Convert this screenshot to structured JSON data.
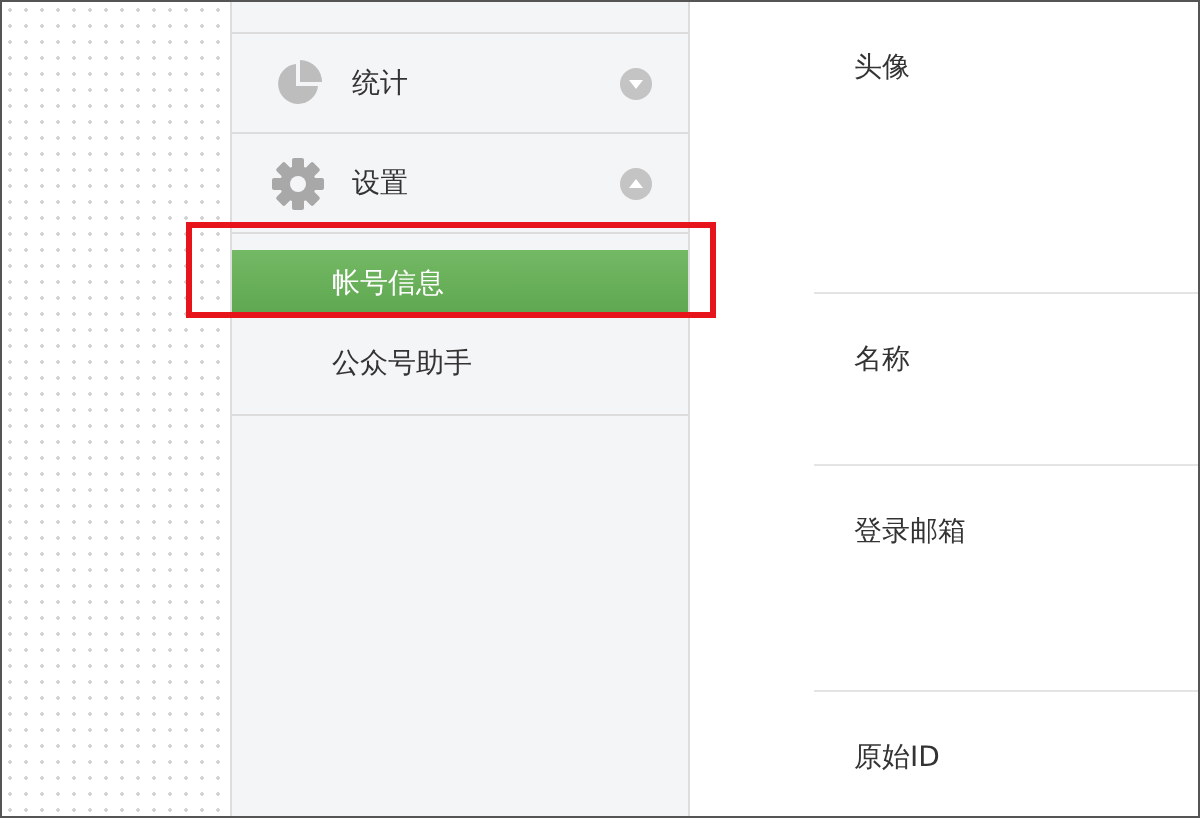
{
  "sidebar": {
    "groups": [
      {
        "label": "统计",
        "kind": "chart",
        "expanded": false
      },
      {
        "label": "设置",
        "kind": "gear",
        "expanded": true,
        "children": [
          {
            "label": "帐号信息",
            "selected": true,
            "highlighted": true
          },
          {
            "label": "公众号助手",
            "selected": false,
            "highlighted": false
          }
        ]
      }
    ]
  },
  "fields": [
    {
      "label": "头像"
    },
    {
      "label": "名称"
    },
    {
      "label": "登录邮箱"
    },
    {
      "label": "原始ID"
    }
  ]
}
